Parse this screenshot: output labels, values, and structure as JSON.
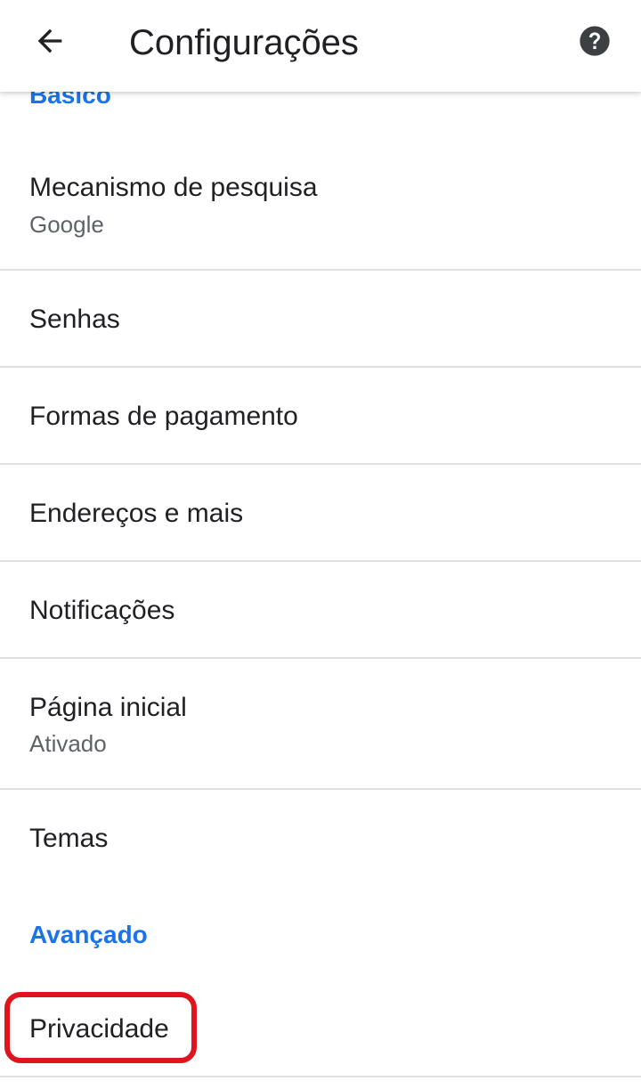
{
  "header": {
    "title": "Configurações",
    "back_icon": "arrow-back-icon",
    "help_icon": "help-icon"
  },
  "sections": {
    "basic": "Básico",
    "advanced": "Avançado"
  },
  "items": [
    {
      "label": "Mecanismo de pesquisa",
      "summary": "Google"
    },
    {
      "label": "Senhas"
    },
    {
      "label": "Formas de pagamento"
    },
    {
      "label": "Endereços e mais"
    },
    {
      "label": "Notificações"
    },
    {
      "label": "Página inicial",
      "summary": "Ativado"
    },
    {
      "label": "Temas"
    },
    {
      "label": "Privacidade"
    }
  ],
  "colors": {
    "accent": "#1a73e8",
    "highlight": "#e0141e",
    "primary_text": "#202124",
    "secondary_text": "#5f6368",
    "divider": "#e0e0e0"
  }
}
